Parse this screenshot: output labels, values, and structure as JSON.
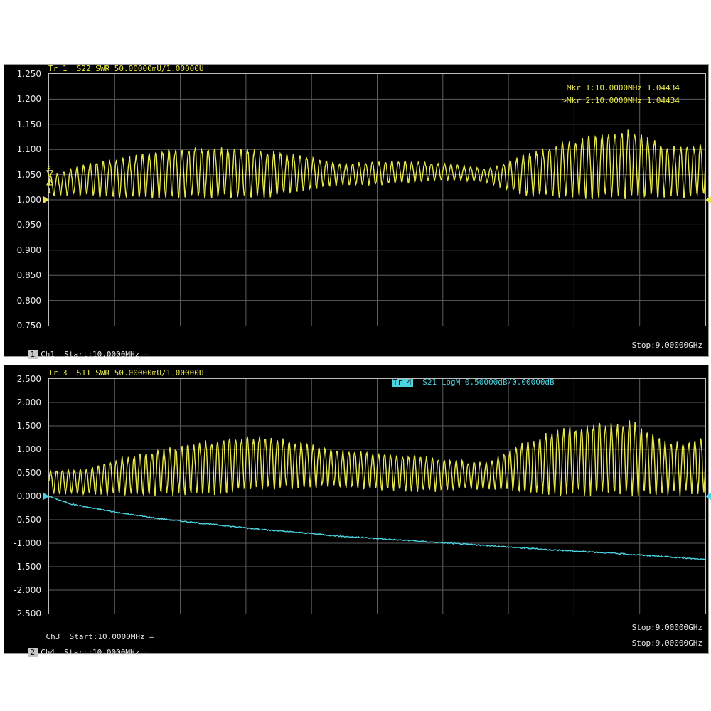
{
  "panel1": {
    "trace_header": "Tr 1  S22 SWR 50.00000mU/1.00000U",
    "marker1": "Mkr 1:10.0000MHz 1.04434",
    "marker2": ">Mkr 2:10.0000MHz 1.04434",
    "channel_badge": "1",
    "channel": "Ch1",
    "start": "Start:10.0000MHz",
    "stop": "Stop:9.00000GHz",
    "marker_labels": [
      "2",
      "1"
    ],
    "colors": {
      "trace": "#e8e84a"
    }
  },
  "panel2": {
    "trace3_header": "Tr 3  S11 SWR 50.00000mU/1.00000U",
    "trace4_badge": "Tr 4",
    "trace4_header": "S21 LogM 0.50000dB/0.00000dB",
    "ch3": "Ch3",
    "ch3_start": "Start:10.0000MHz",
    "ch3_stop": "Stop:9.00000GHz",
    "channel_badge": "2",
    "ch4": "Ch4",
    "ch4_start": "Start:10.0000MHz",
    "ch4_stop": "Stop:9.00000GHz",
    "colors": {
      "trace3": "#e8e84a",
      "trace4": "#4bd3e0"
    }
  },
  "chart_data": [
    {
      "type": "line",
      "title": "Tr 1  S22 SWR 50.00000mU/1.00000U",
      "xlabel": "Start:10.0000MHz — Stop:9.00000GHz",
      "ylim": [
        0.75,
        1.25
      ],
      "yticks": [
        "1.250",
        "1.200",
        "1.150",
        "1.100",
        "1.050",
        "1.000",
        "0.950",
        "0.900",
        "0.850",
        "0.800",
        "0.750"
      ],
      "grid": true,
      "x_range_ghz": [
        0.01,
        9.0
      ],
      "series": [
        {
          "name": "S22 SWR",
          "envelope_x_ghz": [
            0.01,
            0.5,
            1.0,
            1.5,
            2.0,
            2.5,
            3.0,
            3.5,
            4.0,
            4.5,
            5.0,
            5.5,
            6.0,
            6.5,
            7.0,
            7.5,
            8.0,
            8.5,
            9.0
          ],
          "envelope_min": [
            1.01,
            1.01,
            1.005,
            1.005,
            1.005,
            1.005,
            1.005,
            1.02,
            1.03,
            1.03,
            1.035,
            1.04,
            1.035,
            1.01,
            1.005,
            1.005,
            1.005,
            1.005,
            1.005
          ],
          "envelope_max": [
            1.045,
            1.07,
            1.08,
            1.095,
            1.1,
            1.1,
            1.095,
            1.085,
            1.07,
            1.075,
            1.075,
            1.07,
            1.06,
            1.085,
            1.11,
            1.125,
            1.135,
            1.1,
            1.11
          ],
          "ripple_cycles": 100
        }
      ]
    },
    {
      "type": "line",
      "title": "Tr 3  S11 SWR 50.00000mU/1.00000U / Tr 4  S21 LogM 0.50000dB/0.00000dB",
      "ylim": [
        -2.5,
        2.5
      ],
      "yticks": [
        "2.500",
        "2.000",
        "1.500",
        "1.000",
        "0.500",
        "0.000",
        "-0.500",
        "-1.000",
        "-1.500",
        "-2.000",
        "-2.500"
      ],
      "grid": true,
      "x_range_ghz": [
        0.01,
        9.0
      ],
      "series": [
        {
          "name": "S11 SWR",
          "envelope_x_ghz": [
            0.01,
            0.5,
            1.0,
            1.5,
            2.0,
            2.5,
            3.0,
            3.5,
            4.0,
            4.5,
            5.0,
            5.5,
            6.0,
            6.5,
            7.0,
            7.5,
            8.0,
            8.5,
            9.0
          ],
          "envelope_min": [
            0.05,
            0.05,
            0.05,
            0.05,
            0.05,
            0.1,
            0.15,
            0.2,
            0.2,
            0.15,
            0.1,
            0.15,
            0.15,
            0.1,
            0.05,
            0.05,
            0.05,
            0.05,
            0.1
          ],
          "envelope_max": [
            0.55,
            0.55,
            0.8,
            0.95,
            1.1,
            1.2,
            1.25,
            1.1,
            0.95,
            0.9,
            0.85,
            0.75,
            0.7,
            1.1,
            1.4,
            1.5,
            1.55,
            1.1,
            1.2
          ],
          "ripple_cycles": 110
        },
        {
          "name": "S21 LogM",
          "x_ghz": [
            0.01,
            0.3,
            0.6,
            1.0,
            1.5,
            2.0,
            2.5,
            3.0,
            3.5,
            4.0,
            4.5,
            5.0,
            5.5,
            6.0,
            6.5,
            7.0,
            7.5,
            8.0,
            8.5,
            9.0
          ],
          "y_db": [
            0.0,
            -0.16,
            -0.25,
            -0.36,
            -0.47,
            -0.56,
            -0.64,
            -0.72,
            -0.78,
            -0.85,
            -0.9,
            -0.95,
            -1.0,
            -1.05,
            -1.1,
            -1.15,
            -1.19,
            -1.24,
            -1.29,
            -1.35
          ]
        }
      ]
    }
  ]
}
